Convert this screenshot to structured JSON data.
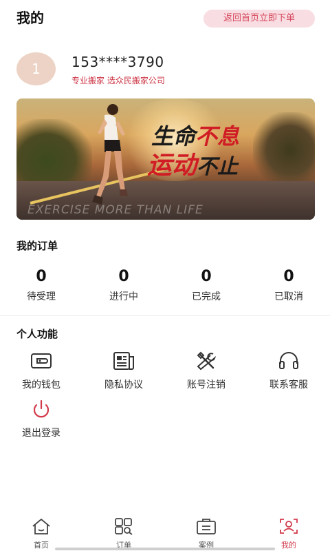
{
  "header": {
    "title": "我的",
    "back_button": "返回首页立即下单"
  },
  "profile": {
    "avatar_text": "1",
    "phone": "153****3790",
    "slogan": "专业搬家 选众民搬家公司"
  },
  "banner": {
    "line1_dark": "生命",
    "line1_red": "不息",
    "line2_red": "运动",
    "line2_dark": "不止",
    "caption": "EXERCISE MORE THAN LIFE"
  },
  "orders": {
    "title": "我的订单",
    "stats": [
      {
        "count": "0",
        "label": "待受理"
      },
      {
        "count": "0",
        "label": "进行中"
      },
      {
        "count": "0",
        "label": "已完成"
      },
      {
        "count": "0",
        "label": "已取消"
      }
    ]
  },
  "functions": {
    "title": "个人功能",
    "items": [
      {
        "label": "我的钱包",
        "icon": "wallet-icon"
      },
      {
        "label": "隐私协议",
        "icon": "document-icon"
      },
      {
        "label": "账号注销",
        "icon": "tools-icon"
      },
      {
        "label": "联系客服",
        "icon": "headset-icon"
      },
      {
        "label": "退出登录",
        "icon": "power-icon"
      }
    ]
  },
  "tabbar": {
    "tabs": [
      {
        "label": "首页",
        "icon": "home-icon"
      },
      {
        "label": "订单",
        "icon": "grid-search-icon"
      },
      {
        "label": "案例",
        "icon": "case-icon"
      },
      {
        "label": "我的",
        "icon": "user-scan-icon",
        "active": true
      }
    ]
  },
  "colors": {
    "accent": "#d23a4b",
    "back_button_bg": "#f8dde2",
    "avatar_bg": "#edd3c5"
  }
}
